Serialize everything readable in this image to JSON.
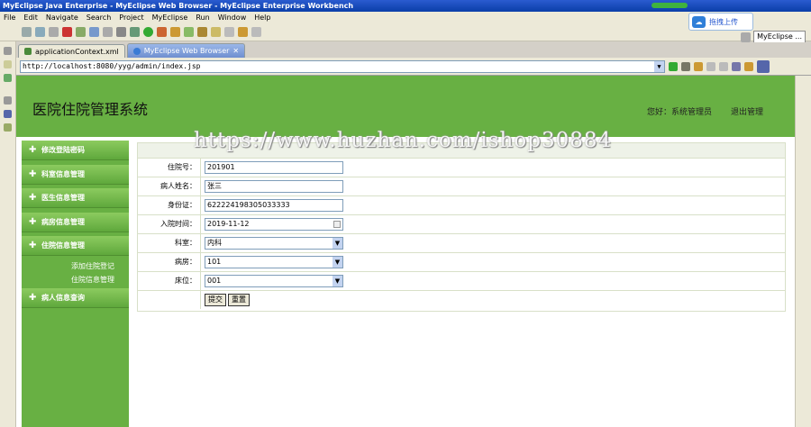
{
  "window": {
    "title": "MyEclipse Java Enterprise - MyEclipse Web Browser - MyEclipse Enterprise Workbench"
  },
  "upload_popup": {
    "label": "拖拽上传"
  },
  "menubar": {
    "items": [
      "File",
      "Edit",
      "Navigate",
      "Search",
      "Project",
      "MyEclipse",
      "Run",
      "Window",
      "Help"
    ]
  },
  "perspective": {
    "label": "MyEclipse ..."
  },
  "tabs": [
    {
      "label": "applicationContext.xml"
    },
    {
      "label": "MyEclipse Web Browser"
    }
  ],
  "address": {
    "url": "http://localhost:8080/yyg/admin/index.jsp"
  },
  "header": {
    "logo": "医院住院管理系统",
    "welcome": "您好：系统管理员",
    "logout": "退出管理"
  },
  "sidebar": {
    "items": [
      "修改登陆密码",
      "科室信息管理",
      "医生信息管理",
      "病房信息管理",
      "住院信息管理",
      "病人信息查询"
    ],
    "subitems": [
      "添加住院登记",
      "住院信息管理"
    ]
  },
  "form": {
    "fields": [
      {
        "label": "住院号：",
        "value": "201901"
      },
      {
        "label": "病人姓名：",
        "value": "张三"
      },
      {
        "label": "身份证：",
        "value": "622224198305033333"
      },
      {
        "label": "入院时间：",
        "value": "2019-11-12"
      },
      {
        "label": "科室：",
        "value": "内科"
      },
      {
        "label": "病房：",
        "value": "101"
      },
      {
        "label": "床位：",
        "value": "001"
      }
    ],
    "submit": "提交",
    "reset": "重置"
  },
  "watermark": "https://www.huzhan.com/ishop30884"
}
